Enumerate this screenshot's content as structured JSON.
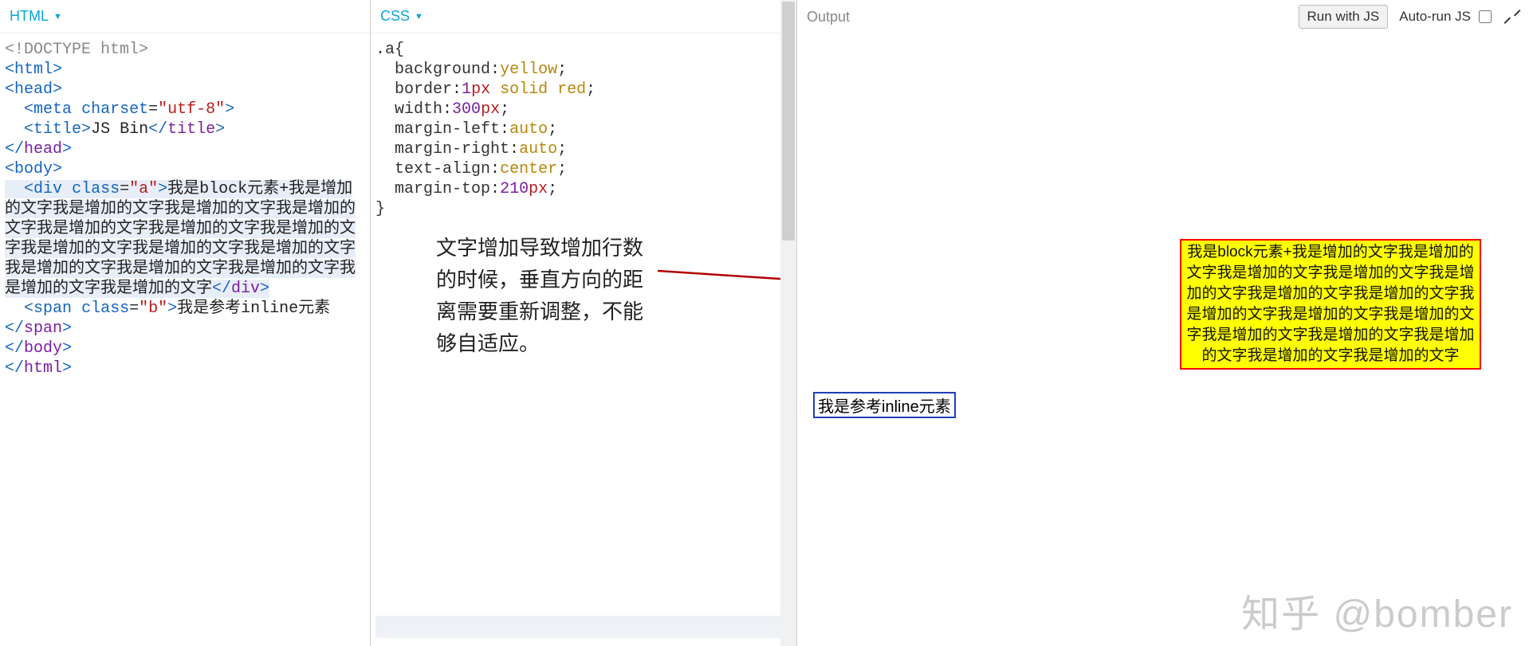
{
  "panels": {
    "html_label": "HTML",
    "css_label": "CSS",
    "output_label": "Output"
  },
  "toolbar": {
    "run_button": "Run with JS",
    "autorun_label": "Auto-run JS"
  },
  "html_code": {
    "doctype": "<!DOCTYPE html>",
    "l2_open": "<",
    "l2_tag": "html",
    "l2_close": ">",
    "l3_open": "<",
    "l3_tag": "head",
    "l3_close": ">",
    "l4_open": "<",
    "l4_tag": "meta",
    "l4_sp": " ",
    "l4_attr": "charset",
    "l4_eq": "=",
    "l4_val": "\"utf-8\"",
    "l4_close": ">",
    "l5_open": "<",
    "l5_tag": "title",
    "l5_close": ">",
    "l5_text": "JS Bin",
    "l5_copen": "</",
    "l5_ctag": "title",
    "l5_cclose": ">",
    "l6_copen": "</",
    "l6_ctag": "head",
    "l6_cclose": ">",
    "l7_open": "<",
    "l7_tag": "body",
    "l7_close": ">",
    "l8_open": "<",
    "l8_tag": "div",
    "l8_sp": " ",
    "l8_attr": "class",
    "l8_eq": "=",
    "l8_val": "\"a\"",
    "l8_close": ">",
    "l8_text": "我是block元素+我是增加的文字我是增加的文字我是增加的文字我是增加的文字我是增加的文字我是增加的文字我是增加的文字我是增加的文字我是增加的文字我是增加的文字我是增加的文字我是增加的文字我是增加的文字我是增加的文字我是增加的文字",
    "l8_copen": "</",
    "l8_ctag": "div",
    "l8_cclose": ">",
    "l9_open": "<",
    "l9_tag": "span",
    "l9_sp": " ",
    "l9_attr": "class",
    "l9_eq": "=",
    "l9_val": "\"b\"",
    "l9_close": ">",
    "l9_text": "我是参考inline元素",
    "l10_copen": "</",
    "l10_ctag": "span",
    "l10_cclose": ">",
    "l11_copen": "</",
    "l11_ctag": "body",
    "l11_cclose": ">",
    "l12_copen": "</",
    "l12_ctag": "html",
    "l12_cclose": ">"
  },
  "css_code": {
    "l1_sel": ".a",
    "l1_brace": "{",
    "l2_prop": "background",
    "l2_colon": ":",
    "l2_val": "yellow",
    "l2_semi": ";",
    "l3_prop": "border",
    "l3_colon": ":",
    "l3_num": "1",
    "l3_unit": "px",
    "l3_sp": " ",
    "l3_kw1": "solid",
    "l3_sp2": " ",
    "l3_kw2": "red",
    "l3_semi": ";",
    "l4_prop": "width",
    "l4_colon": ":",
    "l4_num": "300",
    "l4_unit": "px",
    "l4_semi": ";",
    "l5_prop": "margin-left",
    "l5_colon": ":",
    "l5_val": "auto",
    "l5_semi": ";",
    "l6_prop": "margin-right",
    "l6_colon": ":",
    "l6_val": "auto",
    "l6_semi": ";",
    "l7_prop": "text-align",
    "l7_colon": ":",
    "l7_val": "center",
    "l7_semi": ";",
    "l8_prop": "margin-top",
    "l8_colon": ":",
    "l8_num": "210",
    "l8_unit": "px",
    "l8_semi": ";",
    "l9_brace": "}"
  },
  "annotation_text": "文字增加导致增加行数的时候，垂直方向的距离需要重新调整，不能够自适应。",
  "output": {
    "block_text": "我是block元素+我是增加的文字我是增加的文字我是增加的文字我是增加的文字我是增加的文字我是增加的文字我是增加的文字我是增加的文字我是增加的文字我是增加的文字我是增加的文字我是增加的文字我是增加的文字我是增加的文字我是增加的文字",
    "inline_text": "我是参考inline元素"
  },
  "watermark": "知乎 @bomber"
}
